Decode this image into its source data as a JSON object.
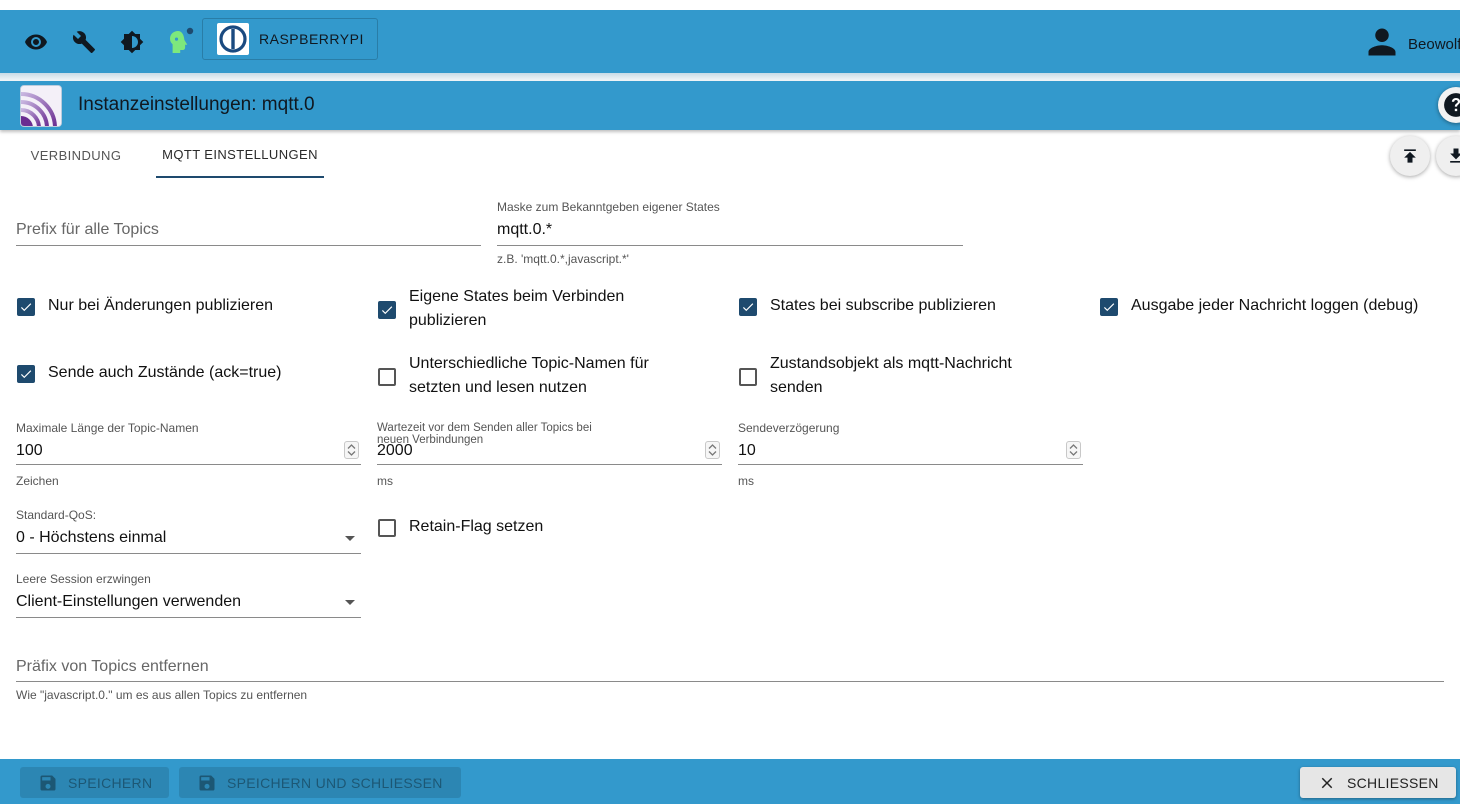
{
  "topbar": {
    "icons": [
      "eye-icon",
      "wrench-icon",
      "brightness-icon",
      "expert-mode-icon"
    ],
    "host_label": "RASPBERRYPI",
    "user_name": "Beowolf"
  },
  "instance": {
    "title": "Instanzeinstellungen: mqtt.0"
  },
  "tabs": [
    {
      "label": "VERBINDUNG",
      "active": false
    },
    {
      "label": "MQTT EINSTELLUNGEN",
      "active": true
    }
  ],
  "fields": {
    "prefix": {
      "placeholder": "Prefix für alle Topics",
      "value": ""
    },
    "mask": {
      "label": "Maske zum Bekanntgeben eigener States",
      "value": "mqtt.0.*",
      "help": "z.B. 'mqtt.0.*,javascript.*'"
    },
    "max_len": {
      "label": "Maximale Länge der Topic-Namen",
      "value": "100",
      "help": "Zeichen"
    },
    "wait": {
      "label_line1": "Wartezeit vor dem Senden aller Topics bei",
      "label_line2": "neuen Verbindungen",
      "value": "2000",
      "help": "ms"
    },
    "send_delay": {
      "label": "Sendeverzögerung",
      "value": "10",
      "help": "ms"
    },
    "qos": {
      "label": "Standard-QoS:",
      "value": "0 - Höchstens einmal"
    },
    "clean_session": {
      "label": "Leere Session erzwingen",
      "value": "Client-Einstellungen verwenden"
    },
    "remove_prefix": {
      "placeholder": "Präfix von Topics entfernen",
      "help": "Wie \"javascript.0.\" um es aus allen Topics zu entfernen"
    }
  },
  "checkboxes": {
    "only_changes": {
      "label": "Nur bei Änderungen publizieren",
      "checked": true
    },
    "own_states_line1": "Eigene States beim Verbinden",
    "own_states_line2": "publizieren",
    "own_states_checked": true,
    "subscribe": {
      "label": "States bei subscribe publizieren",
      "checked": true
    },
    "debug": {
      "label": "Ausgabe jeder Nachricht loggen (debug)",
      "checked": true
    },
    "ack": {
      "label": "Sende auch Zustände (ack=true)",
      "checked": true
    },
    "diff_topics_line1": "Unterschiedliche Topic-Namen für",
    "diff_topics_line2": "setzten und lesen nutzen",
    "diff_topics_checked": false,
    "state_obj_line1": "Zustandsobjekt als mqtt-Nachricht",
    "state_obj_line2": "senden",
    "state_obj_checked": false,
    "retain": {
      "label": "Retain-Flag setzen",
      "checked": false
    }
  },
  "bottom": {
    "save": "SPEICHERN",
    "save_close": "SPEICHERN UND SCHLIESSEN",
    "close": "SCHLIESSEN"
  },
  "colors": {
    "accent": "#3399cc",
    "checkbox": "#1e4a6e",
    "expert_icon": "#7de87d"
  }
}
